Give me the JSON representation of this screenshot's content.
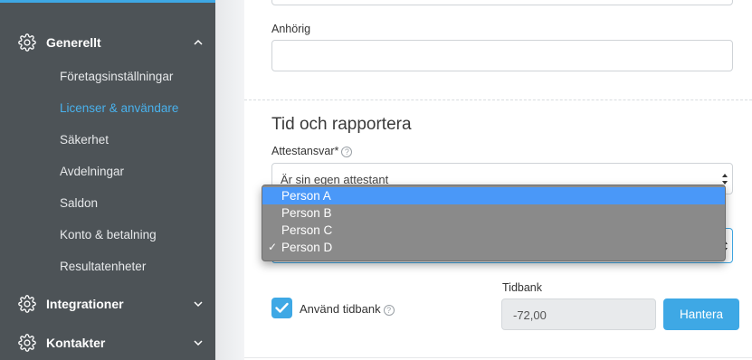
{
  "sidebar": {
    "sections": [
      {
        "label": "Generellt",
        "icon": "gear-icon",
        "expanded": true
      },
      {
        "label": "Integrationer",
        "icon": "gear-icon",
        "expanded": false
      },
      {
        "label": "Kontakter",
        "icon": "gear-icon",
        "expanded": false
      }
    ],
    "items": [
      {
        "label": "Företagsinställningar"
      },
      {
        "label": "Licenser & användare",
        "active": true
      },
      {
        "label": "Säkerhet"
      },
      {
        "label": "Avdelningar"
      },
      {
        "label": "Saldon"
      },
      {
        "label": "Konto & betalning"
      },
      {
        "label": "Resultatenheter"
      }
    ]
  },
  "form": {
    "anhorig_label": "Anhörig",
    "anhorig_value": "",
    "section_title": "Tid och rapportera",
    "attestansvar_label": "Attestansvar*",
    "attestansvar_value": "Är sin egen attestant",
    "person_dropdown": {
      "options": [
        "Person A",
        "Person B",
        "Person C",
        "Person D"
      ],
      "highlighted": "Person A",
      "selected": "Person D"
    },
    "anvand_tidbank_label": "Använd tidbank",
    "anvand_tidbank_checked": true,
    "tidbank_label": "Tidbank",
    "tidbank_value": "-72,00",
    "hantera_button": "Hantera"
  },
  "colors": {
    "sidebar_bg": "#4d5357",
    "accent": "#3ea8e5",
    "active_nav": "#49b1ec",
    "dropdown_bg": "#8a8a8a",
    "dropdown_highlight": "#4a98f8"
  }
}
